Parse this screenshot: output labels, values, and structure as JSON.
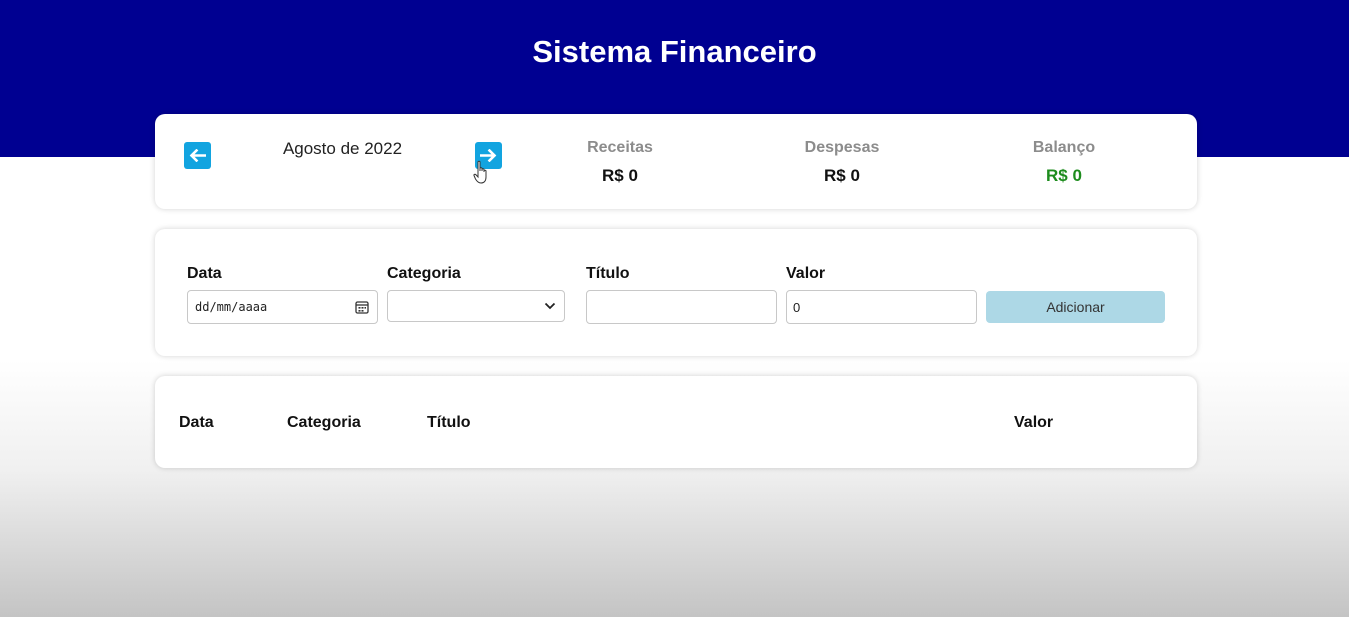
{
  "header": {
    "title": "Sistema Financeiro"
  },
  "info": {
    "month": "Agosto de 2022",
    "receitas": {
      "title": "Receitas",
      "value": "R$ 0"
    },
    "despesas": {
      "title": "Despesas",
      "value": "R$ 0"
    },
    "balanco": {
      "title": "Balanço",
      "value": "R$ 0"
    }
  },
  "form": {
    "data_label": "Data",
    "data_placeholder": "dd/mm/aaaa",
    "categoria_label": "Categoria",
    "categoria_value": "",
    "titulo_label": "Título",
    "titulo_value": "",
    "valor_label": "Valor",
    "valor_value": "0",
    "add_label": "Adicionar"
  },
  "table": {
    "columns": [
      "Data",
      "Categoria",
      "Título",
      "Valor"
    ]
  },
  "colors": {
    "header": "#000091",
    "nav_button": "#12a4e0",
    "add_button": "#add8e6",
    "balance_positive": "#1d8c1d"
  },
  "icons": {
    "prev": "arrow-left-icon",
    "next": "arrow-right-icon",
    "calendar": "calendar-icon",
    "select": "chevron-down-icon",
    "cursor": "hand-pointer-icon"
  }
}
